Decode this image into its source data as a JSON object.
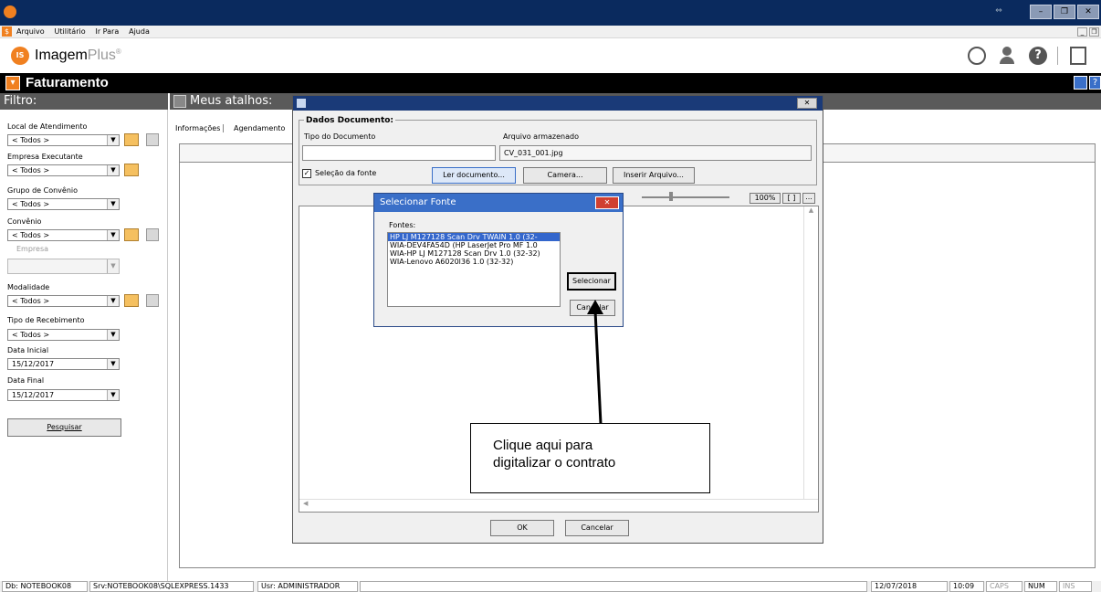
{
  "window": {
    "maximize_label": "⇔",
    "min_label": "–",
    "max_label": "❐",
    "close_label": "✕"
  },
  "menu": {
    "items": [
      "Arquivo",
      "Utilitário",
      "Ir Para",
      "Ajuda"
    ]
  },
  "logo": {
    "text": "Imagem",
    "accent": "Plus",
    "mark": "®"
  },
  "header": {
    "title": "Faturamento"
  },
  "filter": {
    "title": "Filtro:",
    "local_label": "Local de Atendimento",
    "local_value": "< Todos >",
    "empresa_exec_label": "Empresa Executante",
    "empresa_exec_value": "< Todos >",
    "grupo_label": "Grupo de Convênio",
    "grupo_value": "< Todos >",
    "convenio_label": "Convênio",
    "convenio_value": "< Todos >",
    "empresa_label": "Empresa",
    "empresa_value": "",
    "modalidade_label": "Modalidade",
    "modalidade_value": "< Todos >",
    "tipo_receb_label": "Tipo de Recebimento",
    "tipo_receb_value": "< Todos >",
    "data_inicial_label": "Data Inicial",
    "data_inicial_value": "15/12/2017",
    "data_final_label": "Data Final",
    "data_final_value": "15/12/2017",
    "pesquisar_label": "Pesquisar"
  },
  "shortcuts": {
    "title": "Meus atalhos:",
    "tabs": [
      "Informações",
      "Agendamento"
    ]
  },
  "dialog": {
    "group_title": "Dados Documento:",
    "tipo_doc_label": "Tipo do Documento",
    "arquivo_label": "Arquivo armazenado",
    "arquivo_value": "CV_031_001.jpg",
    "selecao_fonte_label": "Seleção da fonte",
    "ler_documento_label": "Ler documento...",
    "camera_label": "Camera...",
    "inserir_arquivo_label": "Inserir Arquivo...",
    "zoom_label": "100%",
    "fit_label": "[ ]",
    "more_label": "...",
    "ok_label": "OK",
    "cancelar_label": "Cancelar",
    "close_label": "✕"
  },
  "select_source": {
    "title": "Selecionar Fonte",
    "fontes_label": "Fontes:",
    "sources": [
      "HP LJ M127128 Scan Drv TWAIN 1.0 (32-",
      "WIA-DEV4FA54D (HP LaserJet Pro MF 1.0",
      "WIA-HP LJ M127128 Scan Drv 1.0 (32-32)",
      "WIA-Lenovo A6020l36 1.0 (32-32)"
    ],
    "selecionar_label": "Selecionar",
    "cancelar_label": "Cancelar",
    "close_label": "✕"
  },
  "callout": {
    "text_line1": "Clique aqui para",
    "text_line2": "digitalizar o contrato"
  },
  "status": {
    "db": "Db: NOTEBOOK08",
    "srv": "Srv:NOTEBOOK08\\SQLEXPRESS.1433",
    "usr": "Usr: ADMINISTRADOR",
    "date": "12/07/2018",
    "time": "10:09",
    "caps": "CAPS",
    "num": "NUM",
    "ins": "INS"
  },
  "colors": {
    "title_bg": "#0a2a5e",
    "header_bg": "#000000",
    "filter_bg": "#5a5a5a",
    "accent_orange": "#f08020",
    "selected_source_bg": "#3366cc",
    "close_red": "#d04030"
  }
}
